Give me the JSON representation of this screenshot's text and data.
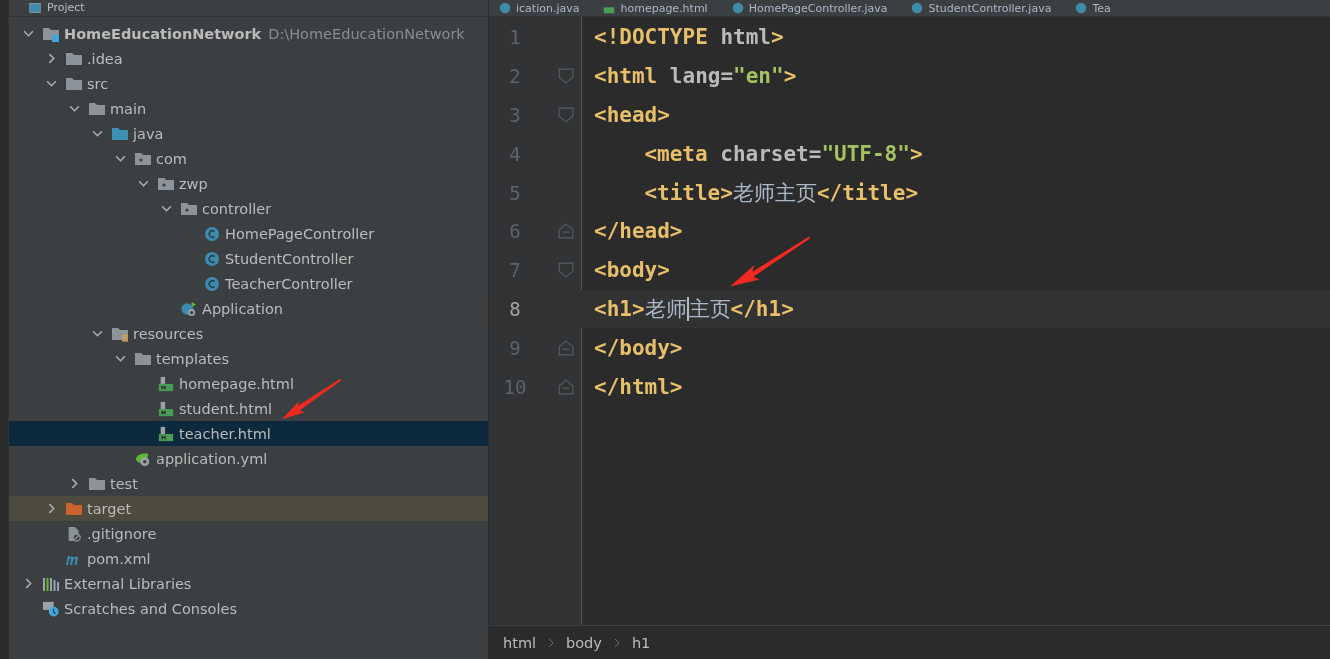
{
  "panel": {
    "title": "Project"
  },
  "tree": [
    {
      "label": "HomeEducationNetwork",
      "path": "D:\\HomeEducationNetwork",
      "kind": "module",
      "expanded": true,
      "selected": false,
      "children": [
        {
          "label": ".idea",
          "kind": "folder",
          "expanded": false,
          "selected": false
        },
        {
          "label": "src",
          "kind": "folder",
          "expanded": true,
          "selected": false,
          "children": [
            {
              "label": "main",
              "kind": "folder",
              "expanded": true,
              "selected": false,
              "children": [
                {
                  "label": "java",
                  "kind": "source-folder",
                  "expanded": true,
                  "selected": false,
                  "children": [
                    {
                      "label": "com",
                      "kind": "package",
                      "expanded": true,
                      "selected": false,
                      "children": [
                        {
                          "label": "zwp",
                          "kind": "package",
                          "expanded": true,
                          "selected": false,
                          "children": [
                            {
                              "label": "controller",
                              "kind": "package",
                              "expanded": true,
                              "selected": false,
                              "children": [
                                {
                                  "label": "HomePageController",
                                  "kind": "class",
                                  "selected": false
                                },
                                {
                                  "label": "StudentController",
                                  "kind": "class",
                                  "selected": false
                                },
                                {
                                  "label": "TeacherController",
                                  "kind": "class",
                                  "selected": false
                                }
                              ]
                            },
                            {
                              "label": "Application",
                              "kind": "app-class",
                              "selected": false
                            }
                          ]
                        }
                      ]
                    }
                  ]
                },
                {
                  "label": "resources",
                  "kind": "resources-folder",
                  "expanded": true,
                  "selected": false,
                  "children": [
                    {
                      "label": "templates",
                      "kind": "folder",
                      "expanded": true,
                      "selected": false,
                      "children": [
                        {
                          "label": "homepage.html",
                          "kind": "html",
                          "selected": false
                        },
                        {
                          "label": "student.html",
                          "kind": "html",
                          "selected": false
                        },
                        {
                          "label": "teacher.html",
                          "kind": "html",
                          "selected": true
                        }
                      ]
                    },
                    {
                      "label": "application.yml",
                      "kind": "yml",
                      "selected": false
                    }
                  ]
                }
              ]
            },
            {
              "label": "test",
              "kind": "folder",
              "expanded": false,
              "selected": false
            }
          ]
        },
        {
          "label": "target",
          "kind": "excluded-folder",
          "expanded": false,
          "selected": false
        },
        {
          "label": ".gitignore",
          "kind": "gitignore",
          "selected": false
        },
        {
          "label": "pom.xml",
          "kind": "maven",
          "selected": false
        }
      ]
    },
    {
      "label": "External Libraries",
      "kind": "libraries",
      "expanded": false,
      "selected": false
    },
    {
      "label": "Scratches and Consoles",
      "kind": "scratches",
      "selected": false
    }
  ],
  "tabs": [
    {
      "label": "ication.java",
      "kind": "java",
      "selected": false
    },
    {
      "label": "homepage.html",
      "kind": "html",
      "selected": false
    },
    {
      "label": "HomePageController.java",
      "kind": "java",
      "selected": false
    },
    {
      "label": "StudentController.java",
      "kind": "java",
      "selected": false
    },
    {
      "label": "Tea",
      "kind": "java",
      "selected": false
    }
  ],
  "lines": [
    {
      "number": "1",
      "current": false,
      "tokens": [
        {
          "kind": "tag",
          "text": "<!DOCTYPE"
        },
        {
          "kind": "plain",
          "text": " html"
        },
        {
          "kind": "tag",
          "text": ">"
        }
      ]
    },
    {
      "number": "2",
      "current": false,
      "fold": {
        "kind": "start"
      },
      "tokens": [
        {
          "kind": "tag",
          "text": "<html"
        },
        {
          "kind": "attr",
          "text": " lang="
        },
        {
          "kind": "value",
          "text": "\"en\""
        },
        {
          "kind": "tag",
          "text": ">"
        }
      ]
    },
    {
      "number": "3",
      "current": false,
      "fold": {
        "kind": "start"
      },
      "tokens": [
        {
          "kind": "tag",
          "text": "<head>"
        }
      ]
    },
    {
      "number": "4",
      "current": false,
      "tokens": [
        {
          "kind": "indent"
        },
        {
          "kind": "tag",
          "text": "<meta"
        },
        {
          "kind": "attr",
          "text": " charset="
        },
        {
          "kind": "value",
          "text": "\"UTF-8\""
        },
        {
          "kind": "tag",
          "text": ">"
        }
      ]
    },
    {
      "number": "5",
      "current": false,
      "tokens": [
        {
          "kind": "indent"
        },
        {
          "kind": "tag",
          "text": "<title>"
        },
        {
          "kind": "text",
          "text": "老师主页"
        },
        {
          "kind": "tag",
          "text": "</title>"
        }
      ]
    },
    {
      "number": "6",
      "current": false,
      "fold": {
        "kind": "end"
      },
      "tokens": [
        {
          "kind": "tag",
          "text": "</head>"
        }
      ]
    },
    {
      "number": "7",
      "current": false,
      "fold": {
        "kind": "start"
      },
      "tokens": [
        {
          "kind": "tag",
          "text": "<body>"
        }
      ]
    },
    {
      "number": "8",
      "current": true,
      "tokens": [
        {
          "kind": "tag",
          "text": "<h1>"
        },
        {
          "kind": "text",
          "text": "老师"
        },
        {
          "kind": "caret"
        },
        {
          "kind": "text",
          "text": "主页"
        },
        {
          "kind": "tag",
          "text": "</h1>"
        }
      ]
    },
    {
      "number": "9",
      "current": false,
      "fold": {
        "kind": "end"
      },
      "tokens": [
        {
          "kind": "tag",
          "text": "</body>"
        }
      ]
    },
    {
      "number": "10",
      "current": false,
      "fold": {
        "kind": "end"
      },
      "tokens": [
        {
          "kind": "tag",
          "text": "</html>"
        }
      ]
    }
  ],
  "breadcrumbs": [
    "html",
    "body",
    "h1"
  ]
}
